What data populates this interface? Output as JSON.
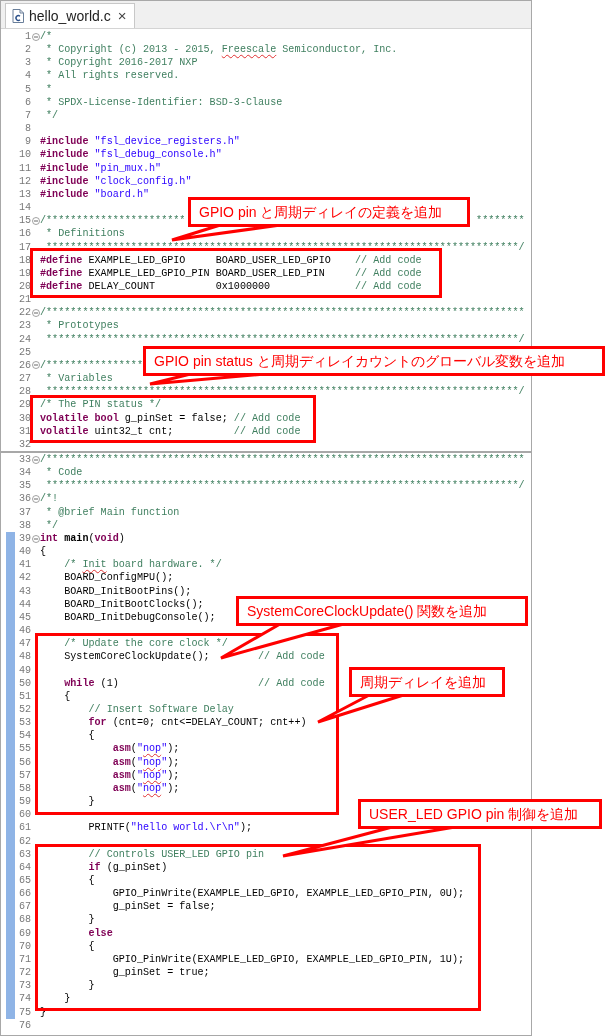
{
  "tab": {
    "title": "hello_world.c",
    "close": "×",
    "selected": true
  },
  "panels": [
    {
      "lines": [
        {
          "n": "1",
          "fold": true,
          "tokens": [
            {
              "kind": "comment",
              "text": "/*"
            }
          ]
        },
        {
          "n": "2",
          "fold": false,
          "tokens": [
            {
              "kind": "comment",
              "text": " * Copyright (c) 2013 - 2015, "
            },
            {
              "kind": "comment_typo",
              "text": "Freescale"
            },
            {
              "kind": "comment",
              "text": " Semiconductor, Inc."
            }
          ]
        },
        {
          "n": "3",
          "fold": false,
          "tokens": [
            {
              "kind": "comment",
              "text": " * Copyright 2016-2017 NXP"
            }
          ]
        },
        {
          "n": "4",
          "fold": false,
          "tokens": [
            {
              "kind": "comment",
              "text": " * All rights reserved."
            }
          ]
        },
        {
          "n": "5",
          "fold": false,
          "tokens": [
            {
              "kind": "comment",
              "text": " *"
            }
          ]
        },
        {
          "n": "6",
          "fold": false,
          "tokens": [
            {
              "kind": "comment",
              "text": " * SPDX-License-Identifier: BSD-3-Clause"
            }
          ]
        },
        {
          "n": "7",
          "fold": false,
          "tokens": [
            {
              "kind": "comment",
              "text": " */"
            }
          ]
        },
        {
          "n": "8",
          "fold": false
        },
        {
          "n": "9",
          "fold": false,
          "tokens": [
            {
              "kind": "keyword",
              "text": "#include"
            },
            {
              "kind": "string",
              "text": " \"fsl_device_registers.h\""
            }
          ]
        },
        {
          "n": "10",
          "fold": false,
          "tokens": [
            {
              "kind": "keyword",
              "text": "#include"
            },
            {
              "kind": "string",
              "text": " \"fsl_debug_console.h\""
            }
          ]
        },
        {
          "n": "11",
          "fold": false,
          "tokens": [
            {
              "kind": "keyword",
              "text": "#include"
            },
            {
              "kind": "string",
              "text": " \"pin_mux.h\""
            }
          ]
        },
        {
          "n": "12",
          "fold": false,
          "tokens": [
            {
              "kind": "keyword",
              "text": "#include"
            },
            {
              "kind": "string",
              "text": " \"clock_config.h\""
            }
          ]
        },
        {
          "n": "13",
          "fold": false,
          "tokens": [
            {
              "kind": "keyword",
              "text": "#include"
            },
            {
              "kind": "string",
              "text": " \"board.h\""
            }
          ]
        },
        {
          "n": "14",
          "fold": false
        },
        {
          "n": "15",
          "fold": true,
          "tokens": [
            {
              "kind": "comment",
              "text": "/***********************"
            },
            {
              "kind": "tail",
              "text": "********"
            }
          ]
        },
        {
          "n": "16",
          "fold": false,
          "tokens": [
            {
              "kind": "comment",
              "text": " * Definitions"
            }
          ]
        },
        {
          "n": "17",
          "fold": false,
          "tokens": [
            {
              "kind": "comment",
              "text": " ******************************************************************************/"
            }
          ]
        },
        {
          "n": "18",
          "fold": false,
          "tokens": [
            {
              "kind": "keyword",
              "text": "#define"
            },
            {
              "kind": "plain",
              "text": " EXAMPLE_LED_GPIO     BOARD_USER_LED_GPIO    "
            },
            {
              "kind": "comment",
              "text": "// Add code"
            }
          ]
        },
        {
          "n": "19",
          "fold": false,
          "tokens": [
            {
              "kind": "keyword",
              "text": "#define"
            },
            {
              "kind": "plain",
              "text": " EXAMPLE_LED_GPIO_PIN BOARD_USER_LED_PIN     "
            },
            {
              "kind": "comment",
              "text": "// Add code"
            }
          ]
        },
        {
          "n": "20",
          "fold": false,
          "tokens": [
            {
              "kind": "keyword",
              "text": "#define"
            },
            {
              "kind": "plain",
              "text": " DELAY_COUNT          0x1000000              "
            },
            {
              "kind": "comment",
              "text": "// Add code"
            }
          ]
        },
        {
          "n": "21",
          "fold": false
        },
        {
          "n": "22",
          "fold": true,
          "tokens": [
            {
              "kind": "comment",
              "text": "/*******************************************************************************"
            }
          ]
        },
        {
          "n": "23",
          "fold": false,
          "tokens": [
            {
              "kind": "comment",
              "text": " * Prototypes"
            }
          ]
        },
        {
          "n": "24",
          "fold": false,
          "tokens": [
            {
              "kind": "comment",
              "text": " ******************************************************************************/"
            }
          ]
        },
        {
          "n": "25",
          "fold": false
        },
        {
          "n": "26",
          "fold": true,
          "tokens": [
            {
              "kind": "comment",
              "text": "/****************"
            }
          ]
        },
        {
          "n": "27",
          "fold": false,
          "tokens": [
            {
              "kind": "comment",
              "text": " * Variables"
            }
          ]
        },
        {
          "n": "28",
          "fold": false,
          "tokens": [
            {
              "kind": "comment",
              "text": " ******************************************************************************/"
            }
          ]
        },
        {
          "n": "29",
          "fold": false,
          "tokens": [
            {
              "kind": "comment",
              "text": "/* The PIN status */"
            }
          ]
        },
        {
          "n": "30",
          "fold": false,
          "tokens": [
            {
              "kind": "keyword",
              "text": "volatile bool"
            },
            {
              "kind": "plain",
              "text": " g_pinSet = false; "
            },
            {
              "kind": "comment",
              "text": "// Add code"
            }
          ]
        },
        {
          "n": "31",
          "fold": false,
          "tokens": [
            {
              "kind": "keyword",
              "text": "volatile"
            },
            {
              "kind": "plain",
              "text": " uint32_t cnt;          "
            },
            {
              "kind": "comment",
              "text": "// Add code"
            }
          ]
        },
        {
          "n": "32",
          "fold": false
        }
      ]
    },
    {
      "lines": [
        {
          "n": "33",
          "fold": true,
          "changed": false,
          "tokens": [
            {
              "kind": "comment",
              "text": "/*******************************************************************************"
            }
          ]
        },
        {
          "n": "34",
          "fold": false,
          "changed": false,
          "tokens": [
            {
              "kind": "comment",
              "text": " * Code"
            }
          ]
        },
        {
          "n": "35",
          "fold": false,
          "changed": false,
          "tokens": [
            {
              "kind": "comment",
              "text": " ******************************************************************************/"
            }
          ]
        },
        {
          "n": "36",
          "fold": true,
          "changed": false,
          "tokens": [
            {
              "kind": "comment",
              "text": "/*!"
            }
          ]
        },
        {
          "n": "37",
          "fold": false,
          "changed": false,
          "tokens": [
            {
              "kind": "comment",
              "text": " * @brief Main function"
            }
          ]
        },
        {
          "n": "38",
          "fold": false,
          "changed": false,
          "tokens": [
            {
              "kind": "comment",
              "text": " */"
            }
          ]
        },
        {
          "n": "39",
          "fold": true,
          "changed": true,
          "tokens": [
            {
              "kind": "keyword",
              "text": "int"
            },
            {
              "kind": "function",
              "text": " main"
            },
            {
              "kind": "plain",
              "text": "("
            },
            {
              "kind": "keyword",
              "text": "void"
            },
            {
              "kind": "plain",
              "text": ")"
            }
          ]
        },
        {
          "n": "40",
          "fold": false,
          "changed": true,
          "tokens": [
            {
              "kind": "plain",
              "text": "{"
            }
          ]
        },
        {
          "n": "41",
          "fold": false,
          "changed": true,
          "tokens": [
            {
              "kind": "comment",
              "text": "    /* "
            },
            {
              "kind": "comment_typo",
              "text": "Init"
            },
            {
              "kind": "comment",
              "text": " board hardware. */"
            }
          ]
        },
        {
          "n": "42",
          "fold": false,
          "changed": true,
          "tokens": [
            {
              "kind": "plain",
              "text": "    BOARD_ConfigMPU();"
            }
          ]
        },
        {
          "n": "43",
          "fold": false,
          "changed": true,
          "tokens": [
            {
              "kind": "plain",
              "text": "    BOARD_InitBootPins();"
            }
          ]
        },
        {
          "n": "44",
          "fold": false,
          "changed": true,
          "tokens": [
            {
              "kind": "plain",
              "text": "    BOARD_InitBootClocks();"
            }
          ]
        },
        {
          "n": "45",
          "fold": false,
          "changed": true,
          "tokens": [
            {
              "kind": "plain",
              "text": "    BOARD_InitDebugConsole();"
            }
          ]
        },
        {
          "n": "46",
          "fold": false,
          "changed": true
        },
        {
          "n": "47",
          "fold": false,
          "changed": true,
          "tokens": [
            {
              "kind": "comment",
              "text": "    /* Update the core clock */"
            }
          ]
        },
        {
          "n": "48",
          "fold": false,
          "changed": true,
          "tokens": [
            {
              "kind": "plain",
              "text": "    SystemCoreClockUpdate();        "
            },
            {
              "kind": "comment",
              "text": "// Add code"
            }
          ]
        },
        {
          "n": "49",
          "fold": false,
          "changed": true
        },
        {
          "n": "50",
          "fold": false,
          "changed": true,
          "tokens": [
            {
              "kind": "keyword",
              "text": "    while"
            },
            {
              "kind": "plain",
              "text": " (1)                       "
            },
            {
              "kind": "comment",
              "text": "// Add code"
            }
          ]
        },
        {
          "n": "51",
          "fold": false,
          "changed": true,
          "tokens": [
            {
              "kind": "plain",
              "text": "    {"
            }
          ]
        },
        {
          "n": "52",
          "fold": false,
          "changed": true,
          "tokens": [
            {
              "kind": "comment",
              "text": "        // Insert Software Delay"
            }
          ]
        },
        {
          "n": "53",
          "fold": false,
          "changed": true,
          "tokens": [
            {
              "kind": "keyword",
              "text": "        for"
            },
            {
              "kind": "plain",
              "text": " (cnt=0; cnt<=DELAY_COUNT; cnt++)"
            }
          ]
        },
        {
          "n": "54",
          "fold": false,
          "changed": true,
          "tokens": [
            {
              "kind": "plain",
              "text": "        {"
            }
          ]
        },
        {
          "n": "55",
          "fold": false,
          "changed": true,
          "tokens": [
            {
              "kind": "keyword",
              "text": "            asm"
            },
            {
              "kind": "plain",
              "text": "("
            },
            {
              "kind": "string",
              "text": "\""
            },
            {
              "kind": "string_typo",
              "text": "nop"
            },
            {
              "kind": "string",
              "text": "\""
            },
            {
              "kind": "plain",
              "text": ");"
            }
          ]
        },
        {
          "n": "56",
          "fold": false,
          "changed": true,
          "tokens": [
            {
              "kind": "keyword",
              "text": "            asm"
            },
            {
              "kind": "plain",
              "text": "("
            },
            {
              "kind": "string",
              "text": "\""
            },
            {
              "kind": "string_typo",
              "text": "nop"
            },
            {
              "kind": "string",
              "text": "\""
            },
            {
              "kind": "plain",
              "text": ");"
            }
          ]
        },
        {
          "n": "57",
          "fold": false,
          "changed": true,
          "tokens": [
            {
              "kind": "keyword",
              "text": "            asm"
            },
            {
              "kind": "plain",
              "text": "("
            },
            {
              "kind": "string",
              "text": "\""
            },
            {
              "kind": "string_typo",
              "text": "nop"
            },
            {
              "kind": "string",
              "text": "\""
            },
            {
              "kind": "plain",
              "text": ");"
            }
          ]
        },
        {
          "n": "58",
          "fold": false,
          "changed": true,
          "tokens": [
            {
              "kind": "keyword",
              "text": "            asm"
            },
            {
              "kind": "plain",
              "text": "("
            },
            {
              "kind": "string",
              "text": "\""
            },
            {
              "kind": "string_typo",
              "text": "nop"
            },
            {
              "kind": "string",
              "text": "\""
            },
            {
              "kind": "plain",
              "text": ");"
            }
          ]
        },
        {
          "n": "59",
          "fold": false,
          "changed": true,
          "tokens": [
            {
              "kind": "plain",
              "text": "        }"
            }
          ]
        },
        {
          "n": "60",
          "fold": false,
          "changed": true
        },
        {
          "n": "61",
          "fold": false,
          "changed": true,
          "tokens": [
            {
              "kind": "plain",
              "text": "        PRINTF("
            },
            {
              "kind": "string",
              "text": "\"hello world.\\r\\n\""
            },
            {
              "kind": "plain",
              "text": ");"
            }
          ]
        },
        {
          "n": "62",
          "fold": false,
          "changed": true
        },
        {
          "n": "63",
          "fold": false,
          "changed": true,
          "tokens": [
            {
              "kind": "comment",
              "text": "        // Controls USER_LED GPIO pin"
            }
          ]
        },
        {
          "n": "64",
          "fold": false,
          "changed": true,
          "tokens": [
            {
              "kind": "keyword",
              "text": "        if"
            },
            {
              "kind": "plain",
              "text": " (g_pinSet)"
            }
          ]
        },
        {
          "n": "65",
          "fold": false,
          "changed": true,
          "tokens": [
            {
              "kind": "plain",
              "text": "        {"
            }
          ]
        },
        {
          "n": "66",
          "fold": false,
          "changed": true,
          "tokens": [
            {
              "kind": "plain",
              "text": "            GPIO_PinWrite(EXAMPLE_LED_GPIO, EXAMPLE_LED_GPIO_PIN, 0U);"
            }
          ]
        },
        {
          "n": "67",
          "fold": false,
          "changed": true,
          "tokens": [
            {
              "kind": "plain",
              "text": "            g_pinSet = false;"
            }
          ]
        },
        {
          "n": "68",
          "fold": false,
          "changed": true,
          "tokens": [
            {
              "kind": "plain",
              "text": "        }"
            }
          ]
        },
        {
          "n": "69",
          "fold": false,
          "changed": true,
          "tokens": [
            {
              "kind": "keyword",
              "text": "        else"
            }
          ]
        },
        {
          "n": "70",
          "fold": false,
          "changed": true,
          "tokens": [
            {
              "kind": "plain",
              "text": "        {"
            }
          ]
        },
        {
          "n": "71",
          "fold": false,
          "changed": true,
          "tokens": [
            {
              "kind": "plain",
              "text": "            GPIO_PinWrite(EXAMPLE_LED_GPIO, EXAMPLE_LED_GPIO_PIN, 1U);"
            }
          ]
        },
        {
          "n": "72",
          "fold": false,
          "changed": true,
          "tokens": [
            {
              "kind": "plain",
              "text": "            g_pinSet = true;"
            }
          ]
        },
        {
          "n": "73",
          "fold": false,
          "changed": true,
          "tokens": [
            {
              "kind": "plain",
              "text": "        }"
            }
          ]
        },
        {
          "n": "74",
          "fold": false,
          "changed": true,
          "tokens": [
            {
              "kind": "plain",
              "text": "    }"
            }
          ]
        },
        {
          "n": "75",
          "fold": false,
          "changed": true,
          "tokens": [
            {
              "kind": "plain",
              "text": "}"
            }
          ]
        },
        {
          "n": "76",
          "fold": false,
          "changed": false
        }
      ]
    }
  ],
  "callouts": [
    {
      "text": "GPIO pin と周期ディレイの定義を追加"
    },
    {
      "text": "GPIO pin status と周期ディレイカウントのグローバル変数を追加"
    },
    {
      "text": "SystemCoreClockUpdate() 関数を追加"
    },
    {
      "text": "周期ディレイを追加"
    },
    {
      "text": "USER_LED GPIO pin 制御を追加"
    }
  ]
}
